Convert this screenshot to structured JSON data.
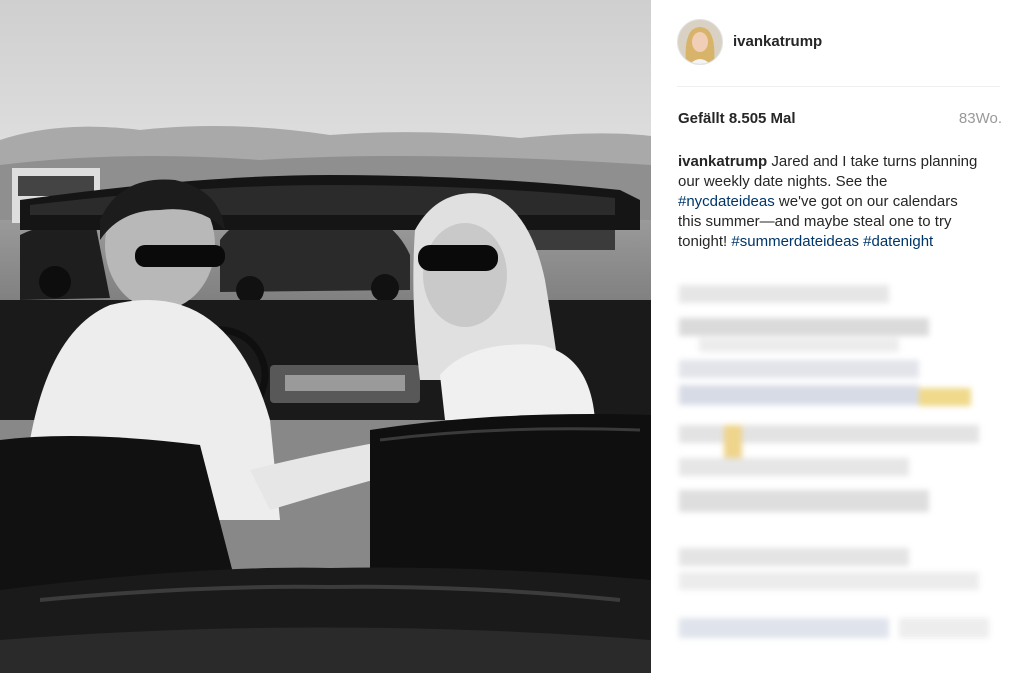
{
  "post": {
    "username": "ivankatrump",
    "likes_label": "Gefällt 8.505 Mal",
    "age": "83Wo.",
    "caption": {
      "username": "ivankatrump",
      "text_1": "Jared and I take turns planning our weekly date nights. See the",
      "hashtag_1": "#nycdateideas",
      "text_2": "we've got on our calendars this summer—and maybe steal one to try tonight!",
      "hashtag_2": "#summerdateideas",
      "hashtag_3": "#datenight"
    }
  },
  "icons": {
    "avatar": "profile-photo",
    "photo": "black-and-white-convertible-photo"
  },
  "colors": {
    "hashtag": "#003569",
    "text": "#262626",
    "muted": "#999999"
  }
}
